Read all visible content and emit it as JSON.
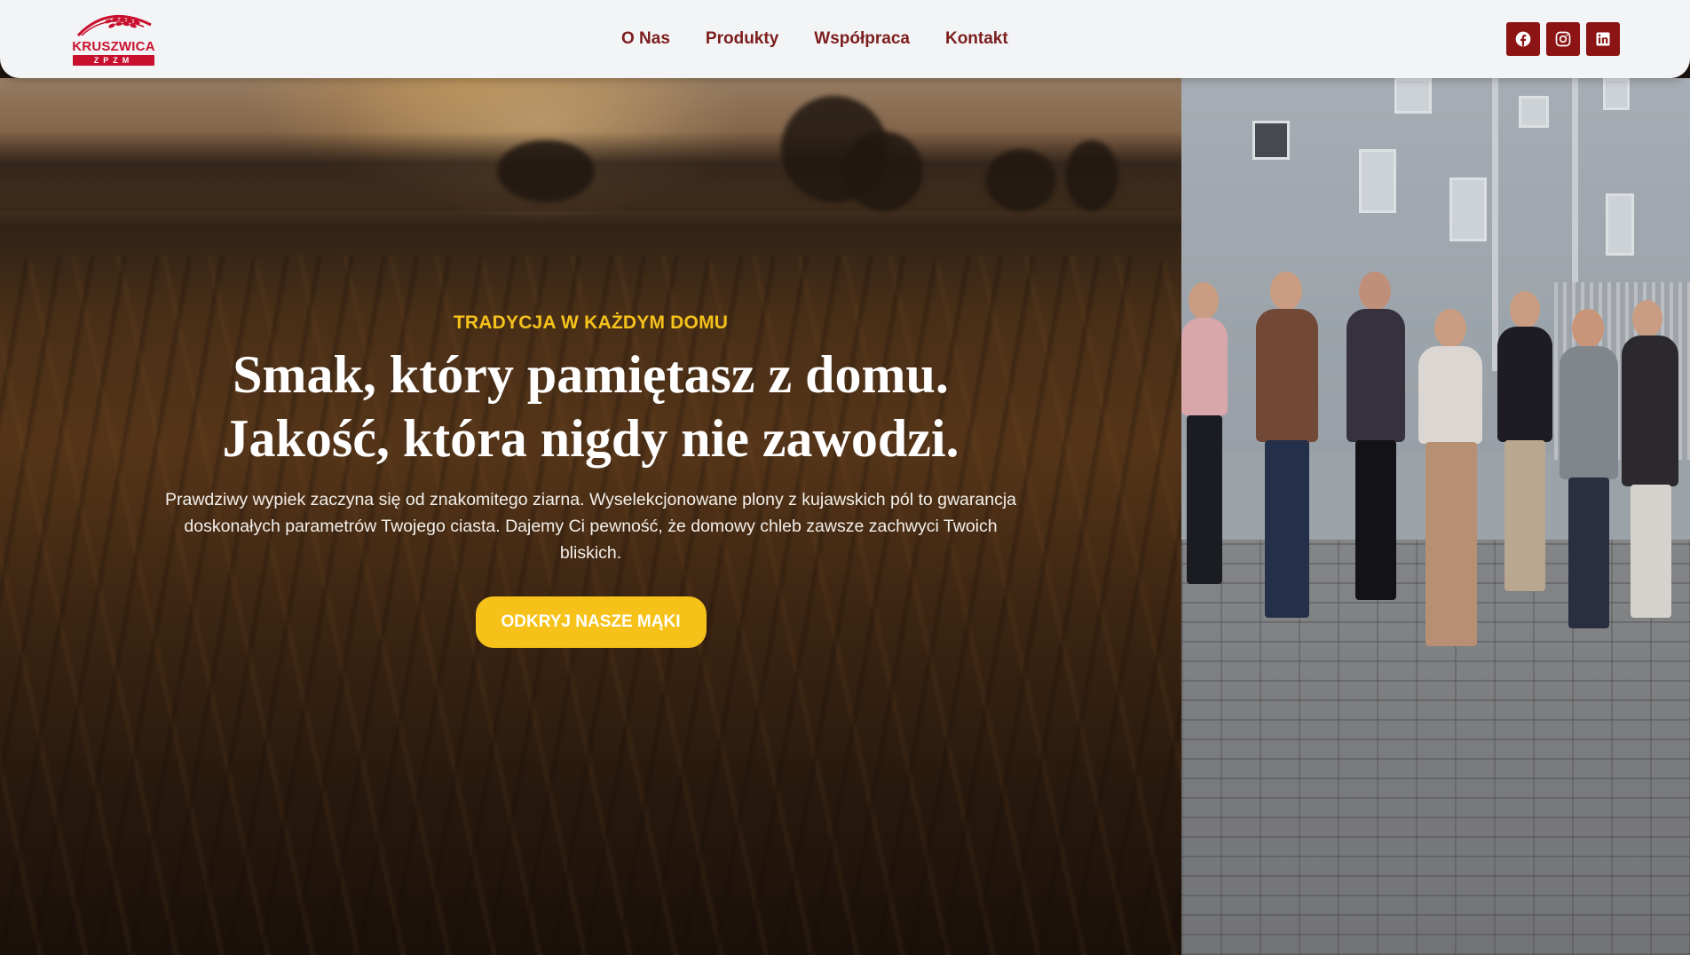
{
  "brand": {
    "name": "KRUSZWICA",
    "sub": "ZPZM"
  },
  "nav": {
    "items": [
      {
        "label": "O Nas"
      },
      {
        "label": "Produkty"
      },
      {
        "label": "Współpraca"
      },
      {
        "label": "Kontakt"
      }
    ]
  },
  "socials": [
    {
      "icon": "facebook-icon"
    },
    {
      "icon": "instagram-icon"
    },
    {
      "icon": "linkedin-icon"
    }
  ],
  "colors": {
    "header_bg": "#f3f4f6",
    "nav_text": "#7c1d1d",
    "social_bg": "#8c1414",
    "brand_red": "#c8102e",
    "accent_yellow": "#f5c21b"
  },
  "hero": {
    "eyebrow": "TRADYCJA W KAŻDYM DOMU",
    "headline_line1": "Smak, który pamiętasz z domu.",
    "headline_line2": "Jakość, która nigdy nie zawodzi.",
    "lead": "Prawdziwy wypiek zaczyna się od znakomitego ziarna. Wyselekcjonowane plony z kujawskich pól to gwarancja doskonałych parametrów Twojego ciasta. Dajemy Ci pewność, że domowy chleb zawsze zachwyci Twoich bliskich.",
    "cta_label": "ODKRYJ NASZE MĄKI"
  }
}
